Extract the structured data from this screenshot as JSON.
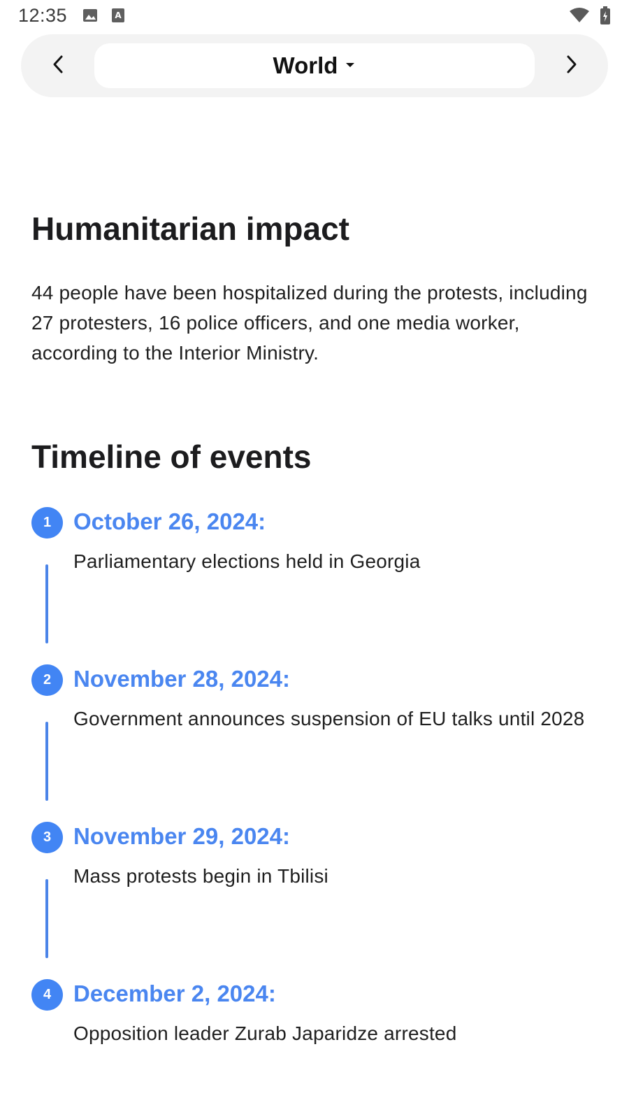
{
  "status_bar": {
    "time": "12:35",
    "left_icons": [
      "image-icon",
      "text-a-icon"
    ],
    "right_icons": [
      "wifi-icon",
      "battery-charging-icon"
    ]
  },
  "topbar": {
    "section": "World",
    "prev_icon": "chevron-left-icon",
    "next_icon": "chevron-right-icon",
    "dropdown_icon": "caret-down-icon"
  },
  "humanitarian": {
    "heading": "Humanitarian impact",
    "body": "44 people have been hospitalized during the protests, including 27 protesters, 16 police officers, and one media worker, according to the Interior Ministry."
  },
  "timeline": {
    "heading": "Timeline of events",
    "items": [
      {
        "number": "1",
        "date": "October 26, 2024:",
        "text": "Parliamentary elections held in Georgia"
      },
      {
        "number": "2",
        "date": "November 28, 2024:",
        "text": "Government announces suspension of EU talks until 2028"
      },
      {
        "number": "3",
        "date": "November 29, 2024:",
        "text": "Mass protests begin in Tbilisi"
      },
      {
        "number": "4",
        "date": "December 2, 2024:",
        "text": "Opposition leader Zurab Japaridze arrested"
      }
    ]
  },
  "colors": {
    "accent": "#4285f4",
    "topbar_bg": "#f3f3f3",
    "text": "#1c1c1e"
  }
}
